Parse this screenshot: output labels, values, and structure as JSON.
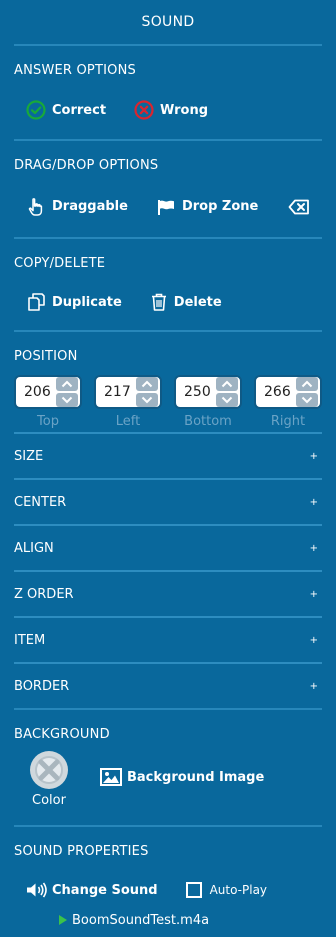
{
  "panel": {
    "title": "SOUND"
  },
  "answer_options": {
    "label": "ANSWER OPTIONS",
    "correct": "Correct",
    "wrong": "Wrong",
    "correct_color": "#18a93a",
    "wrong_color": "#d9252f"
  },
  "drag_drop": {
    "label": "DRAG/DROP OPTIONS",
    "draggable": "Draggable",
    "drop_zone": "Drop Zone"
  },
  "copy_delete": {
    "label": "COPY/DELETE",
    "duplicate": "Duplicate",
    "delete": "Delete"
  },
  "position": {
    "label": "POSITION",
    "fields": [
      {
        "value": "206",
        "caption": "Top"
      },
      {
        "value": "217",
        "caption": "Left"
      },
      {
        "value": "250",
        "caption": "Bottom"
      },
      {
        "value": "266",
        "caption": "Right"
      }
    ]
  },
  "collapsed_sections": [
    {
      "label": "SIZE",
      "icon": "+"
    },
    {
      "label": "CENTER",
      "icon": "+"
    },
    {
      "label": "ALIGN",
      "icon": "+"
    },
    {
      "label": "Z ORDER",
      "icon": "+"
    },
    {
      "label": "ITEM",
      "icon": "+"
    },
    {
      "label": "BORDER",
      "icon": "+"
    }
  ],
  "background": {
    "label": "BACKGROUND",
    "color_label": "Color",
    "image_label": "Background Image"
  },
  "sound_properties": {
    "label": "SOUND PROPERTIES",
    "change_sound": "Change Sound",
    "auto_play": "Auto-Play",
    "file_name": "BoomSoundTest.m4a",
    "play_color": "#3bc24a"
  },
  "theme": {
    "background": "#09689c",
    "divider": "#2d8dc0"
  }
}
